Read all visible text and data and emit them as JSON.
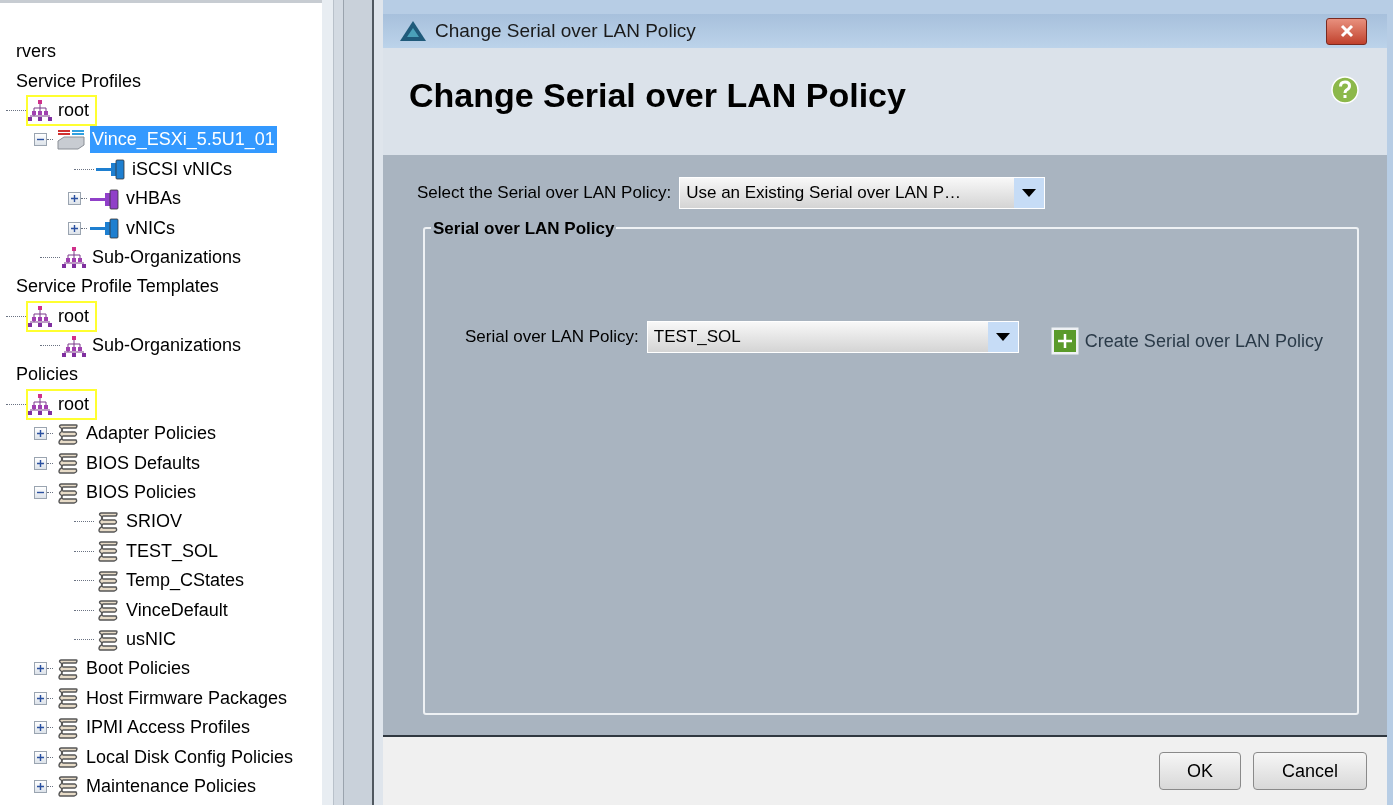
{
  "tree": [
    {
      "label": "rvers",
      "kind": "section"
    },
    {
      "label": "Service Profiles",
      "kind": "section"
    },
    {
      "label": "root",
      "kind": "org",
      "outlined": true,
      "children": [
        {
          "label": "Vince_ESXi_5.5U1_01",
          "kind": "server",
          "selected": true,
          "expanded": true,
          "children": [
            {
              "label": "iSCSI vNICs",
              "kind": "vnic"
            },
            {
              "label": "vHBAs",
              "kind": "vhba",
              "expanded": false
            },
            {
              "label": "vNICs",
              "kind": "vnic",
              "expanded": false
            }
          ]
        },
        {
          "label": "Sub-Organizations",
          "kind": "org",
          "outlined": false
        }
      ]
    },
    {
      "label": "Service Profile Templates",
      "kind": "section"
    },
    {
      "label": "root",
      "kind": "org",
      "outlined": true,
      "children": [
        {
          "label": "Sub-Organizations",
          "kind": "org",
          "outlined": false
        }
      ]
    },
    {
      "label": "Policies",
      "kind": "section"
    },
    {
      "label": "root",
      "kind": "org",
      "outlined": true,
      "children": [
        {
          "label": "Adapter Policies",
          "kind": "policy",
          "expanded": false
        },
        {
          "label": "BIOS Defaults",
          "kind": "policy",
          "expanded": false
        },
        {
          "label": "BIOS Policies",
          "kind": "policy",
          "expanded": true,
          "children": [
            {
              "label": "SRIOV",
              "kind": "policy"
            },
            {
              "label": "TEST_SOL",
              "kind": "policy"
            },
            {
              "label": "Temp_CStates",
              "kind": "policy"
            },
            {
              "label": "VinceDefault",
              "kind": "policy"
            },
            {
              "label": "usNIC",
              "kind": "policy"
            }
          ]
        },
        {
          "label": "Boot Policies",
          "kind": "policy",
          "expanded": false
        },
        {
          "label": "Host Firmware Packages",
          "kind": "policy",
          "expanded": false
        },
        {
          "label": "IPMI Access Profiles",
          "kind": "policy",
          "expanded": false
        },
        {
          "label": "Local Disk Config Policies",
          "kind": "policy",
          "expanded": false
        },
        {
          "label": "Maintenance Policies",
          "kind": "policy",
          "expanded": false
        }
      ]
    }
  ],
  "dialog": {
    "title": "Change Serial over LAN Policy",
    "heading": "Change Serial over LAN Policy",
    "select": {
      "label": "Select the Serial over LAN Policy:",
      "value": "Use an Existing Serial over LAN P…"
    },
    "group": {
      "legend": "Serial over LAN Policy",
      "field": {
        "label": "Serial over LAN Policy:",
        "value": "TEST_SOL"
      },
      "link": "Create Serial over LAN Policy"
    },
    "buttons": [
      {
        "label": "OK"
      },
      {
        "label": "Cancel"
      }
    ]
  }
}
